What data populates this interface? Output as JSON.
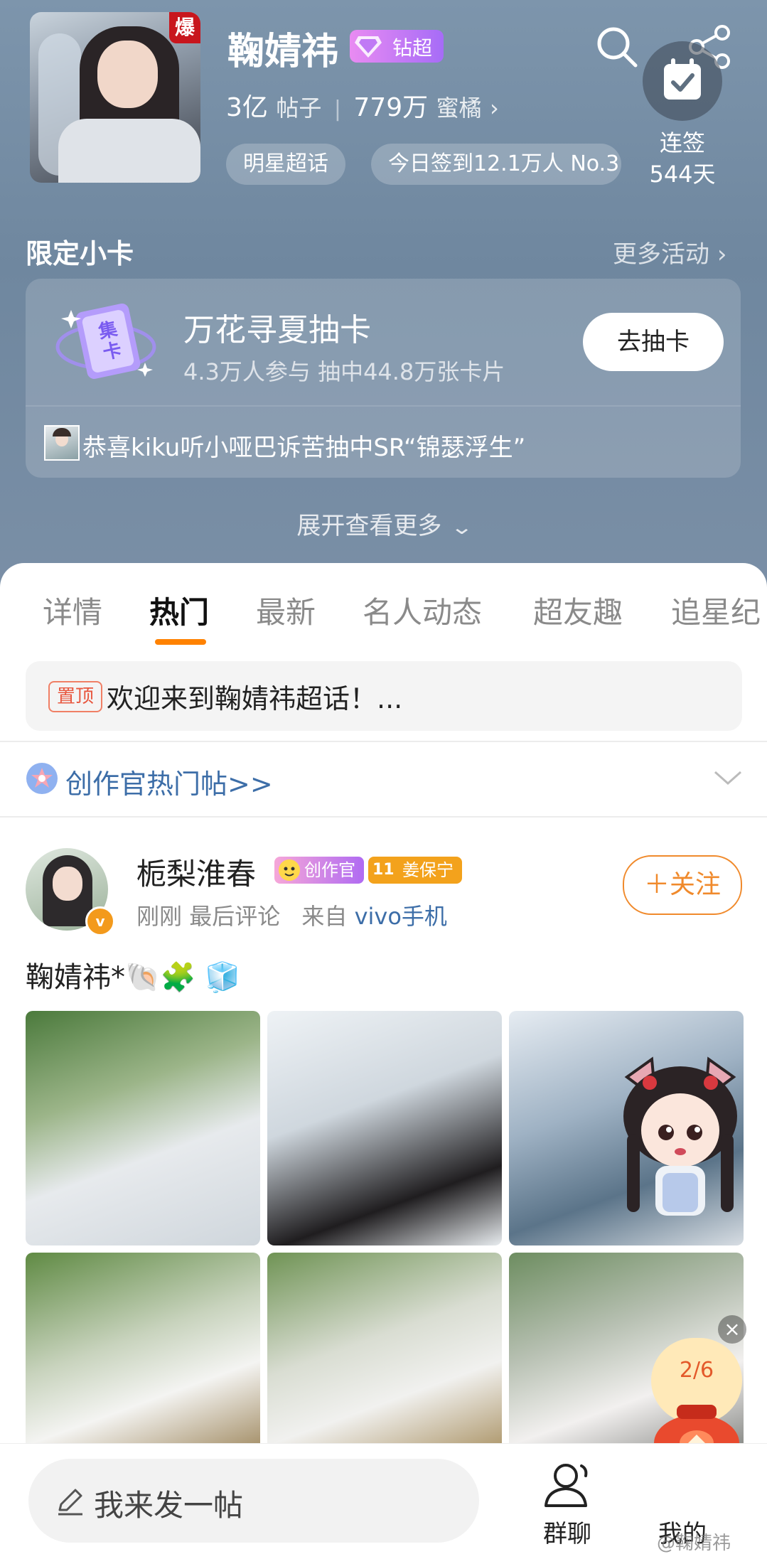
{
  "header": {
    "title": "鞠婧祎",
    "level_badge": "钻超",
    "cover_badge": "爆",
    "posts_count": "3亿",
    "posts_label": "帖子",
    "fans_count": "779万",
    "fans_label": "蜜橘",
    "tags": [
      "明星超话",
      "今日签到12.1万人 No.3"
    ],
    "checkin_label": "连签",
    "checkin_days": "544天",
    "icons": [
      "back-arrow-icon",
      "search-icon",
      "share-icon",
      "calendar-check-icon"
    ]
  },
  "limited_card": {
    "section_title": "限定小卡",
    "more_label": "更多活动",
    "event_title": "万花寻夏抽卡",
    "event_stats": "4.3万人参与 抽中44.8万张卡片",
    "icon_text": "集卡",
    "draw_button": "去抽卡",
    "winner_text": "恭喜kiku听小哑巴诉苦抽中SR“锦瑟浮生”",
    "expand_label": "展开查看更多"
  },
  "tabs": [
    "详情",
    "热门",
    "最新",
    "名人动态",
    "超友趣",
    "追星纪"
  ],
  "active_tab": "热门",
  "pinned": {
    "badge": "置顶",
    "text": "欢迎来到鞠婧祎超话！..."
  },
  "creator_hot": {
    "label": "创作官热门帖>>"
  },
  "post": {
    "username": "栀梨淮春",
    "badge_creator": "创作官",
    "badge_fan_level": "11",
    "badge_fan_name": "姜保宁",
    "time": "刚刚",
    "last_action": "最后评论",
    "source_prefix": "来自",
    "source": "vivo手机",
    "follow_button": "＋关注",
    "content": "鞠婧祎*🐚🧩 🧊",
    "photo_count": 6
  },
  "floating": {
    "lucky_counter": "2/6",
    "watermark": "@鞠婧祎"
  },
  "bottom_bar": {
    "compose_placeholder": "我来发一帖",
    "group_chat": "群聊",
    "mine": "我的"
  },
  "colors": {
    "accent": "#ff8200",
    "header_bg": "#7a90a7",
    "link_blue": "#3d6ea8",
    "follow_orange": "#f08a2c"
  }
}
